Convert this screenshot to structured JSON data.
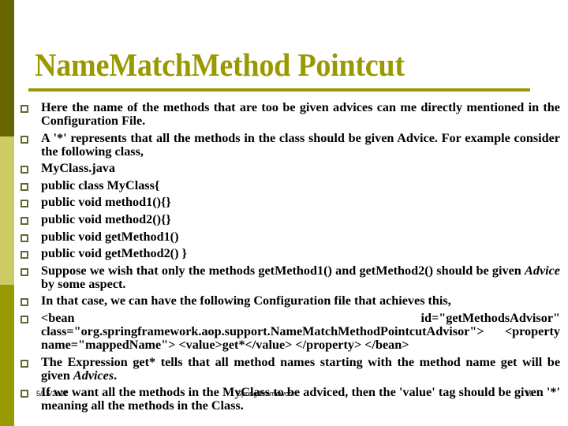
{
  "slide": {
    "title": "NameMatchMethod Pointcut",
    "colors": {
      "sidebar_top": "#666600",
      "sidebar_middle": "#cccc66",
      "sidebar_bottom": "#999900",
      "title": "#999900",
      "bullet": "#666633"
    },
    "bullets": [
      {
        "text": "Here the name of the methods that are too be given advices can me directly mentioned in the Configuration File."
      },
      {
        "text": "A '*' represents that all the methods in the class should be given Advice. For example consider the following class,"
      },
      {
        "text": "MyClass.java"
      },
      {
        "text": "public class MyClass{"
      },
      {
        "text": "public void method1(){}"
      },
      {
        "text": "public void method2(){}"
      },
      {
        "text": "public void getMethod1()"
      },
      {
        "text": "public void getMethod2() }"
      },
      {
        "before": "Suppose we wish that only the methods getMethod1() and getMethod2() should be given ",
        "emphasis": "Advice",
        "after": " by some aspect."
      },
      {
        "text": "In that case, we can have the following Configuration file that achieves this,"
      },
      {
        "text": "<bean id=\"getMethodsAdvisor\" class=\"org.springframework.aop.support.NameMatchMethodPointcutAdvisor\"> <property name=\"mappedName\"> <value>get*</value> </property> </bean>"
      },
      {
        "before": "The Expression get* tells that all method names starting with the method name get will be given ",
        "emphasis": "Advices",
        "after": "."
      },
      {
        "text": "If we want all the methods in the MyClass to be adviced, then the 'value' tag should be given '*' meaning all the methods in the Class."
      }
    ],
    "footer": {
      "date": "5/15/2021",
      "center": "Spring Framework",
      "page": "16"
    }
  }
}
